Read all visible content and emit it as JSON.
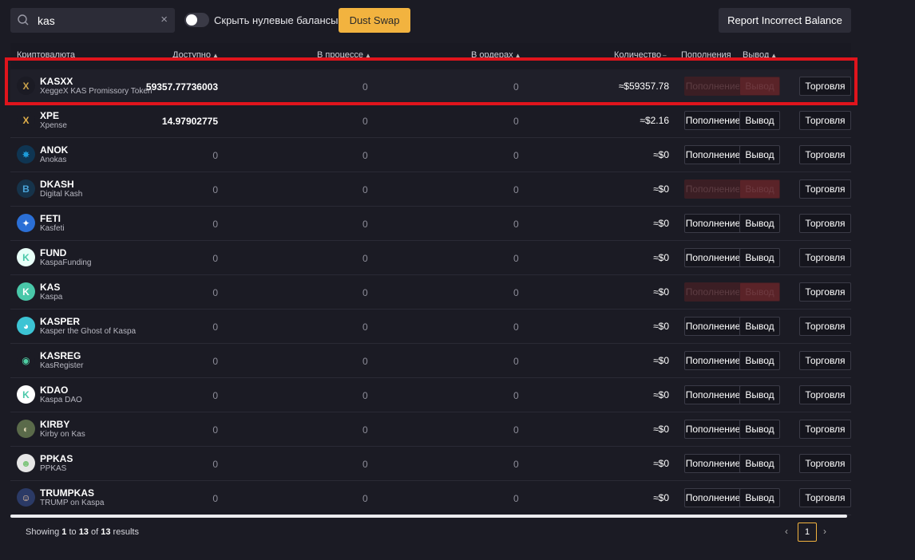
{
  "search": {
    "value": "kas",
    "clear": "×"
  },
  "toggle": {
    "label": "Скрыть нулевые балансы"
  },
  "buttons": {
    "dust_swap": "Dust Swap",
    "report": "Report Incorrect Balance"
  },
  "table": {
    "headers": {
      "crypto": "Криптовалюта",
      "available": "Доступно",
      "in_process": "В процессе",
      "in_orders": "В ордерах",
      "amount": "Количество",
      "deposits": "Пополнения",
      "withdraw": "Вывод"
    },
    "rows": [
      {
        "symbol": "KASXX",
        "name": "XeggeX KAS Promissory Token",
        "available": "59357.77736003",
        "in_process": "0",
        "in_orders": "0",
        "amount": "≈$59357.78",
        "deposit": "Пополнение",
        "withdraw": "Вывод",
        "trade": "Торговля",
        "disabled": true,
        "icon": "kasxx-icon",
        "icon_glyph": "X",
        "icon_color": "#c9a24a",
        "icon_bg": "#1b1b24"
      },
      {
        "symbol": "XPE",
        "name": "Xpense",
        "available": "14.97902775",
        "in_process": "0",
        "in_orders": "0",
        "amount": "≈$2.16",
        "deposit": "Пополнение",
        "withdraw": "Вывод",
        "trade": "Торговля",
        "disabled": false,
        "icon": "xpe-icon",
        "icon_glyph": "X",
        "icon_color": "#e2b04a",
        "icon_bg": "#1b1b24"
      },
      {
        "symbol": "ANOK",
        "name": "Anokas",
        "available": "0",
        "in_process": "0",
        "in_orders": "0",
        "amount": "≈$0",
        "deposit": "Пополнение",
        "withdraw": "Вывод",
        "trade": "Торговля",
        "disabled": false,
        "icon": "anok-icon",
        "icon_glyph": "✸",
        "icon_color": "#1d9bd9",
        "icon_bg": "#0f3552"
      },
      {
        "symbol": "DKASH",
        "name": "Digital Kash",
        "available": "0",
        "in_process": "0",
        "in_orders": "0",
        "amount": "≈$0",
        "deposit": "Пополнение",
        "withdraw": "Вывод",
        "trade": "Торговля",
        "disabled": true,
        "icon": "dkash-icon",
        "icon_glyph": "B",
        "icon_color": "#4aa3d8",
        "icon_bg": "#16334a"
      },
      {
        "symbol": "FETI",
        "name": "Kasfeti",
        "available": "0",
        "in_process": "0",
        "in_orders": "0",
        "amount": "≈$0",
        "deposit": "Пополнение",
        "withdraw": "Вывод",
        "trade": "Торговля",
        "disabled": false,
        "icon": "feti-icon",
        "icon_glyph": "✦",
        "icon_color": "#ffffff",
        "icon_bg": "#2b6fd6"
      },
      {
        "symbol": "FUND",
        "name": "KaspaFunding",
        "available": "0",
        "in_process": "0",
        "in_orders": "0",
        "amount": "≈$0",
        "deposit": "Пополнение",
        "withdraw": "Вывод",
        "trade": "Торговля",
        "disabled": false,
        "icon": "fund-icon",
        "icon_glyph": "K",
        "icon_color": "#49c8a9",
        "icon_bg": "#e8fff8"
      },
      {
        "symbol": "KAS",
        "name": "Kaspa",
        "available": "0",
        "in_process": "0",
        "in_orders": "0",
        "amount": "≈$0",
        "deposit": "Пополнение",
        "withdraw": "Вывод",
        "trade": "Торговля",
        "disabled": true,
        "icon": "kas-icon",
        "icon_glyph": "K",
        "icon_color": "#ffffff",
        "icon_bg": "#49c8a9"
      },
      {
        "symbol": "KASPER",
        "name": "Kasper the Ghost of Kaspa",
        "available": "0",
        "in_process": "0",
        "in_orders": "0",
        "amount": "≈$0",
        "deposit": "Пополнение",
        "withdraw": "Вывод",
        "trade": "Торговля",
        "disabled": false,
        "icon": "kasper-icon",
        "icon_glyph": "◕",
        "icon_color": "#ffffff",
        "icon_bg": "#3cc4d4"
      },
      {
        "symbol": "KASREG",
        "name": "KasRegister",
        "available": "0",
        "in_process": "0",
        "in_orders": "0",
        "amount": "≈$0",
        "deposit": "Пополнение",
        "withdraw": "Вывод",
        "trade": "Торговля",
        "disabled": false,
        "icon": "kasreg-icon",
        "icon_glyph": "◉",
        "icon_color": "#4fd0a4",
        "icon_bg": "#1b1b24"
      },
      {
        "symbol": "KDAO",
        "name": "Kaspa DAO",
        "available": "0",
        "in_process": "0",
        "in_orders": "0",
        "amount": "≈$0",
        "deposit": "Пополнение",
        "withdraw": "Вывод",
        "trade": "Торговля",
        "disabled": false,
        "icon": "kdao-icon",
        "icon_glyph": "K",
        "icon_color": "#49c8a9",
        "icon_bg": "#ffffff"
      },
      {
        "symbol": "KIRBY",
        "name": "Kirby on Kas",
        "available": "0",
        "in_process": "0",
        "in_orders": "0",
        "amount": "≈$0",
        "deposit": "Пополнение",
        "withdraw": "Вывод",
        "trade": "Торговля",
        "disabled": false,
        "icon": "kirby-icon",
        "icon_glyph": "◐",
        "icon_color": "#d9d2b0",
        "icon_bg": "#5a6a4a"
      },
      {
        "symbol": "PPKAS",
        "name": "PPKAS",
        "available": "0",
        "in_process": "0",
        "in_orders": "0",
        "amount": "≈$0",
        "deposit": "Пополнение",
        "withdraw": "Вывод",
        "trade": "Торговля",
        "disabled": false,
        "icon": "ppkas-icon",
        "icon_glyph": "☻",
        "icon_color": "#7cc47a",
        "icon_bg": "#e6e6e6"
      },
      {
        "symbol": "TRUMPKAS",
        "name": "TRUMP on Kaspa",
        "available": "0",
        "in_process": "0",
        "in_orders": "0",
        "amount": "≈$0",
        "deposit": "Пополнение",
        "withdraw": "Вывод",
        "trade": "Торговля",
        "disabled": false,
        "icon": "trumpkas-icon",
        "icon_glyph": "☺",
        "icon_color": "#f0c8a0",
        "icon_bg": "#2b3a66"
      }
    ]
  },
  "footer": {
    "showing_prefix": "Showing ",
    "from": "1",
    "to_word": " to ",
    "to": "13",
    "of_word": " of ",
    "total": "13",
    "suffix": " results",
    "page": "1",
    "prev": "‹",
    "next": "›"
  }
}
